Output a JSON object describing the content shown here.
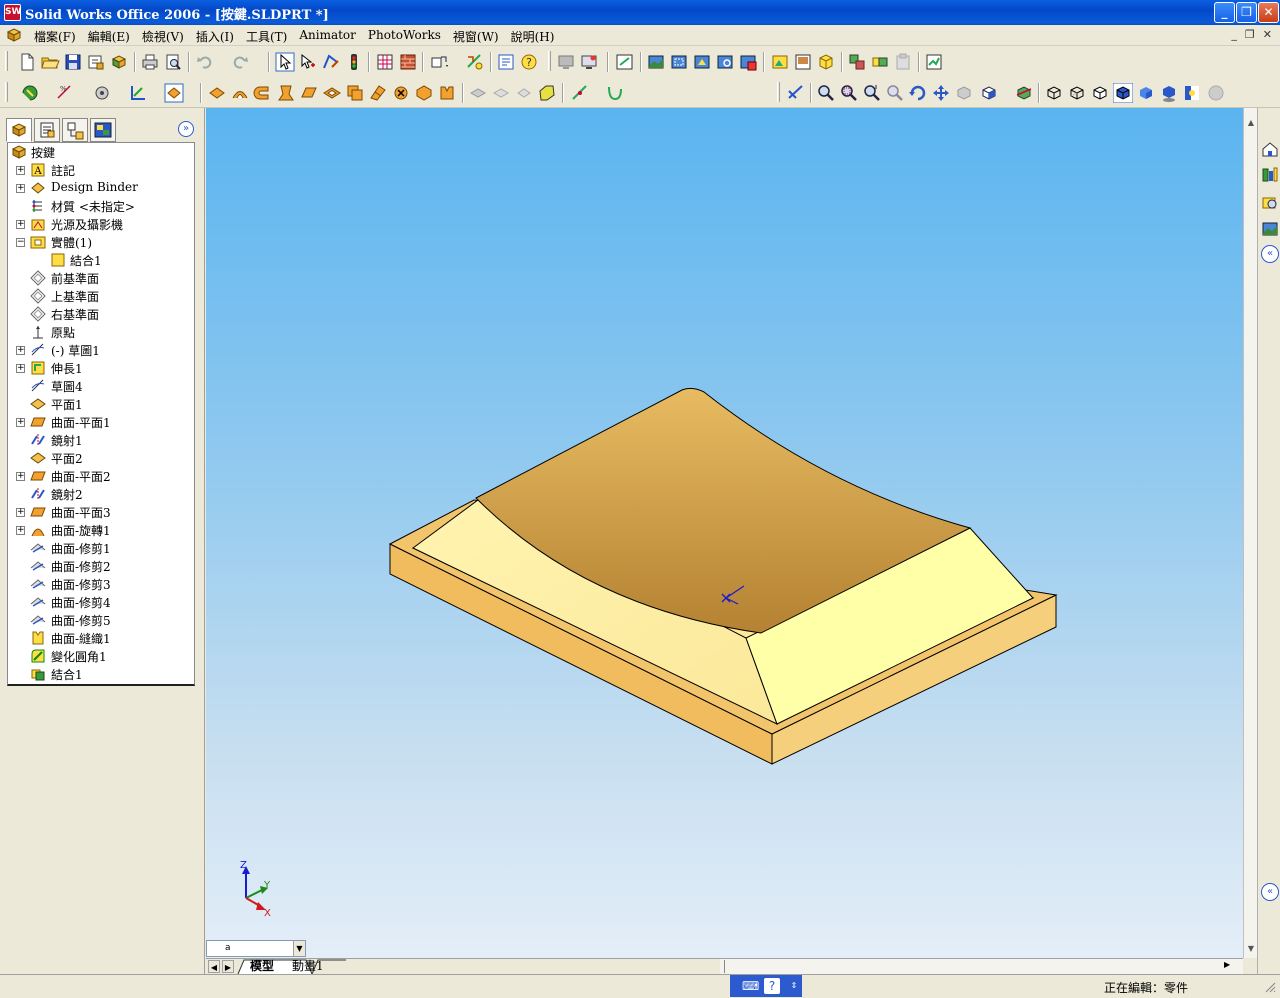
{
  "window": {
    "title": "Solid Works Office 2006 - [按鍵.SLDPRT *]",
    "app_icon_label": "SW",
    "minimize": "_",
    "maximize": "❐",
    "close": "✕"
  },
  "menubar": {
    "items": [
      "檔案(F)",
      "編輯(E)",
      "檢視(V)",
      "插入(I)",
      "工具(T)",
      "Animator",
      "PhotoWorks",
      "視窗(W)",
      "說明(H)"
    ],
    "mdi": [
      "_",
      "❐",
      "✕"
    ]
  },
  "feature_tree": {
    "root": "按鍵",
    "items": [
      {
        "label": "註記",
        "icon": "annotation-icon",
        "exp": "+"
      },
      {
        "label": "Design Binder",
        "icon": "design-binder-icon",
        "exp": "+"
      },
      {
        "label": "材質 <未指定>",
        "icon": "material-icon",
        "exp": ""
      },
      {
        "label": "光源及攝影機",
        "icon": "lights-icon",
        "exp": "+"
      },
      {
        "label": "實體(1)",
        "icon": "solid-bodies-icon",
        "exp": "−"
      },
      {
        "label": "結合1",
        "icon": "body-icon",
        "exp": ""
      },
      {
        "label": "前基準面",
        "icon": "plane-icon",
        "exp": ""
      },
      {
        "label": "上基準面",
        "icon": "plane-icon",
        "exp": ""
      },
      {
        "label": "右基準面",
        "icon": "plane-icon",
        "exp": ""
      },
      {
        "label": "原點",
        "icon": "origin-icon",
        "exp": ""
      },
      {
        "label": "(-) 草圖1",
        "icon": "sketch-icon",
        "exp": "+"
      },
      {
        "label": "伸長1",
        "icon": "extrude-icon",
        "exp": "+"
      },
      {
        "label": "草圖4",
        "icon": "sketch-icon",
        "exp": ""
      },
      {
        "label": "平面1",
        "icon": "ref-plane-icon",
        "exp": ""
      },
      {
        "label": "曲面-平面1",
        "icon": "surface-icon",
        "exp": "+"
      },
      {
        "label": "鏡射1",
        "icon": "mirror-icon",
        "exp": ""
      },
      {
        "label": "平面2",
        "icon": "ref-plane-icon",
        "exp": ""
      },
      {
        "label": "曲面-平面2",
        "icon": "surface-icon",
        "exp": "+"
      },
      {
        "label": "鏡射2",
        "icon": "mirror-icon",
        "exp": ""
      },
      {
        "label": "曲面-平面3",
        "icon": "surface-icon",
        "exp": "+"
      },
      {
        "label": "曲面-旋轉1",
        "icon": "revolve-surface-icon",
        "exp": "+"
      },
      {
        "label": "曲面-修剪1",
        "icon": "trim-surface-icon",
        "exp": ""
      },
      {
        "label": "曲面-修剪2",
        "icon": "trim-surface-icon",
        "exp": ""
      },
      {
        "label": "曲面-修剪3",
        "icon": "trim-surface-icon",
        "exp": ""
      },
      {
        "label": "曲面-修剪4",
        "icon": "trim-surface-icon",
        "exp": ""
      },
      {
        "label": "曲面-修剪5",
        "icon": "trim-surface-icon",
        "exp": ""
      },
      {
        "label": "曲面-縫織1",
        "icon": "knit-surface-icon",
        "exp": ""
      },
      {
        "label": "變化圓角1",
        "icon": "fillet-icon",
        "exp": ""
      },
      {
        "label": "結合1",
        "icon": "combine-icon",
        "exp": ""
      }
    ]
  },
  "triad": {
    "z": "Z",
    "y": "Y",
    "x": "X"
  },
  "bottom": {
    "config_value": "a",
    "tabs": [
      "模型",
      "動畫1"
    ]
  },
  "status": {
    "text": "正在編輯：零件"
  },
  "colors": {
    "part_top": "#d9a650",
    "part_light": "#fff6a8",
    "part_side": "#f0c060",
    "viewport_top": "#5ab4f0",
    "viewport_bottom": "#e4eef8"
  }
}
